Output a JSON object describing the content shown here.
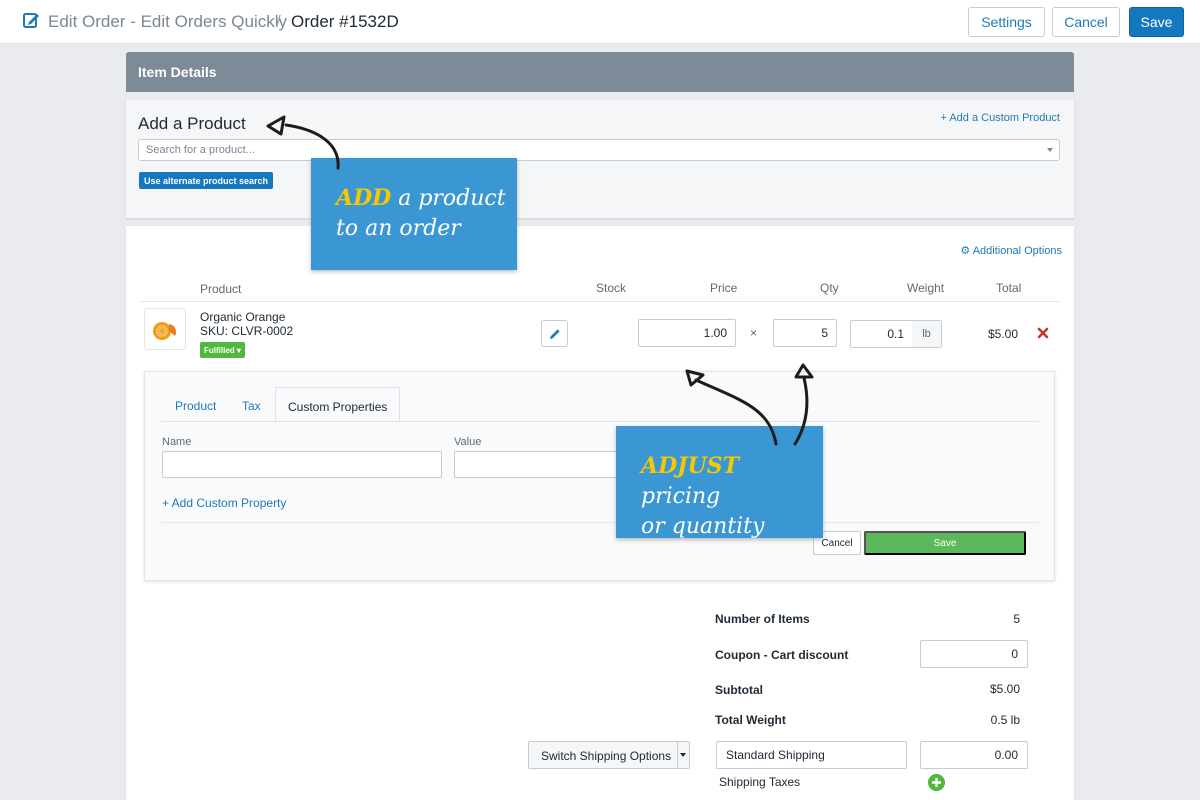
{
  "header": {
    "app_title": "Edit Order - Edit Orders Quickly",
    "separator": "/",
    "order_title": "Order #1532D",
    "settings_label": "Settings",
    "cancel_label": "Cancel",
    "save_label": "Save"
  },
  "item_details": {
    "title": "Item Details"
  },
  "add_product": {
    "title": "Add a Product",
    "custom_link": "+ Add a Custom Product",
    "search_placeholder": "Search for a product...",
    "alt_search_label": "Use alternate product search"
  },
  "table": {
    "additional_options": "Additional Options",
    "columns": {
      "product": "Product",
      "stock": "Stock",
      "price": "Price",
      "qty": "Qty",
      "weight": "Weight",
      "total": "Total"
    },
    "row": {
      "name": "Organic Orange",
      "sku": "SKU: CLVR-0002",
      "status": "Fulfilled",
      "price": "1.00",
      "times": "×",
      "qty": "5",
      "weight": "0.1",
      "weight_unit": "lb",
      "total": "$5.00"
    }
  },
  "properties": {
    "tabs": [
      "Product",
      "Tax",
      "Custom Properties"
    ],
    "name_label": "Name",
    "value_label": "Value",
    "add_property": "+ Add Custom Property",
    "cancel_label": "Cancel",
    "save_label": "Save"
  },
  "summary": {
    "items_label": "Number of Items",
    "items_value": "5",
    "coupon_label": "Coupon - Cart discount",
    "coupon_value": "0",
    "subtotal_label": "Subtotal",
    "subtotal_value": "$5.00",
    "weight_label": "Total Weight",
    "weight_value": "0.5 lb",
    "switch_shipping": "Switch Shipping Options",
    "shipping_method": "Standard Shipping",
    "shipping_cost": "0.00",
    "shipping_taxes": "Shipping Taxes"
  },
  "callouts": {
    "add_highlight": "ADD",
    "add_line1_rest": " a product",
    "add_line2": "to an order",
    "adjust_highlight": "ADJUST",
    "adjust_line1_rest": " pricing",
    "adjust_line2": "or quantity"
  },
  "colors": {
    "primary_blue": "#1577bd",
    "link_blue": "#1f7ab8",
    "callout_blue": "#3b97d3",
    "callout_highlight": "#f6c800",
    "success_green": "#5cb85c",
    "remove_red": "#c0392b"
  }
}
